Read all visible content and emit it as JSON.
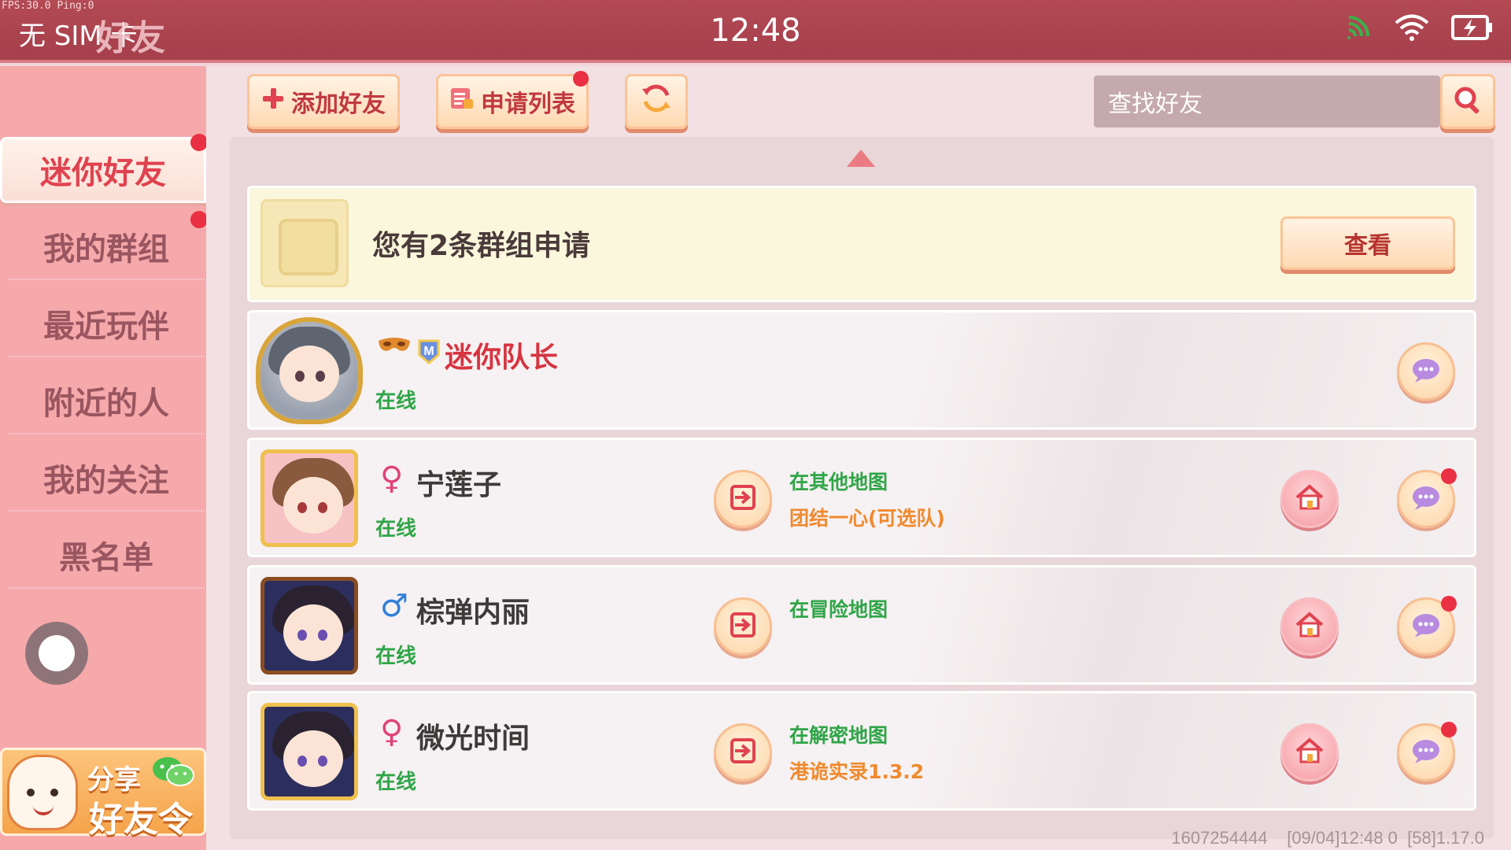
{
  "status_bar": {
    "debug": "FPS:30.0  Ping:0",
    "carrier": "无 SIM 卡",
    "time": "12:48",
    "icons": [
      "cast-icon",
      "wifi-icon",
      "battery-charging-icon"
    ]
  },
  "title": "好友",
  "sidebar": {
    "items": [
      {
        "label": "迷你好友",
        "active": true,
        "badge": true
      },
      {
        "label": "我的群组",
        "active": false,
        "badge": true
      },
      {
        "label": "最近玩伴",
        "active": false,
        "badge": false
      },
      {
        "label": "附近的人",
        "active": false,
        "badge": false
      },
      {
        "label": "我的关注",
        "active": false,
        "badge": false
      },
      {
        "label": "黑名单",
        "active": false,
        "badge": false
      }
    ],
    "share": {
      "line1": "分享",
      "line2": "好友令",
      "icon": "wechat-icon"
    }
  },
  "toolbar": {
    "add_friend": "添加好友",
    "request_list": "申请列表",
    "refresh_icon": "refresh-icon",
    "search_placeholder": "查找好友"
  },
  "group_request": {
    "text": "您有2条群组申请",
    "view_label": "查看"
  },
  "friends": [
    {
      "name": "迷你队长",
      "status": "在线",
      "gender": "",
      "map_status": "",
      "map_name": "",
      "badges": [
        "mask-icon",
        "vip-badge-icon"
      ]
    },
    {
      "name": "宁莲子",
      "status": "在线",
      "gender": "♀",
      "map_status": "在其他地图",
      "map_name": "团结一心(可选队)"
    },
    {
      "name": "棕弹内丽",
      "status": "在线",
      "gender": "♂",
      "map_status": "在冒险地图",
      "map_name": ""
    },
    {
      "name": "微光时间",
      "status": "在线",
      "gender": "♀",
      "map_status": "在解密地图",
      "map_name": "港诡实录1.3.2"
    }
  ],
  "footer": "1607254444    [09/04]12:48 0  [58]1.17.0",
  "colors": {
    "header": "#a53f4b",
    "sidebar": "#f6a9ab",
    "accent_red": "#e0424f",
    "online_green": "#2fa548",
    "map_orange": "#ef8a2e",
    "female": "#e0427a",
    "male": "#2f7fd8"
  }
}
